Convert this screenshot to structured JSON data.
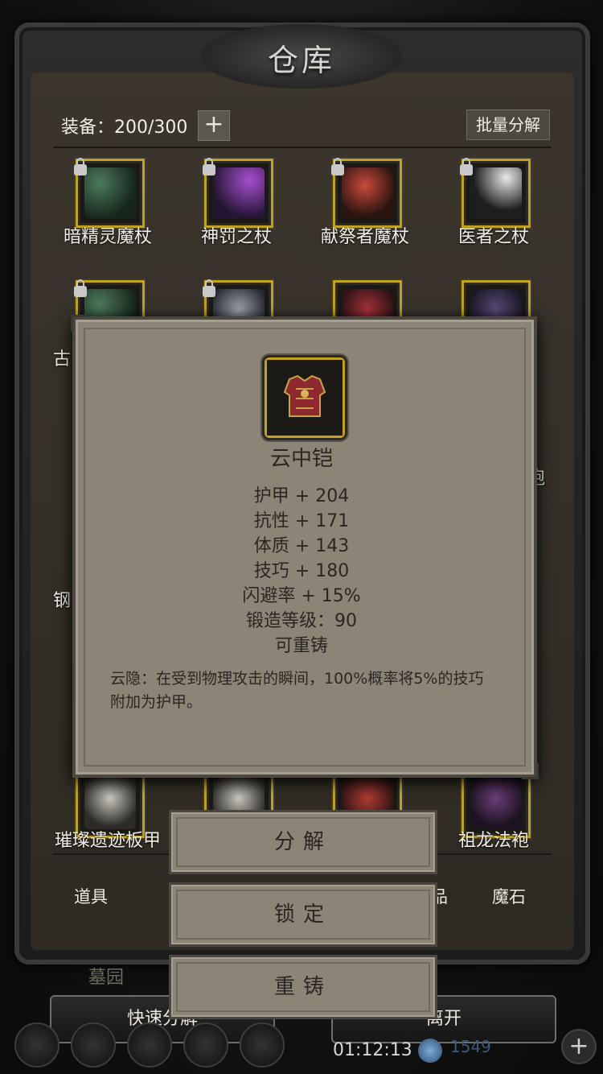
{
  "warehouse": {
    "title": "仓库",
    "equip_count": "装备：200/300",
    "add_slot_label": "+",
    "bulk_decompose_label": "批量分解"
  },
  "items": [
    {
      "name": "暗精灵魔杖",
      "locked": true,
      "art": "staff-green"
    },
    {
      "name": "神罚之杖",
      "locked": true,
      "art": "staff-purple"
    },
    {
      "name": "献祭者魔杖",
      "locked": true,
      "art": "staff-red"
    },
    {
      "name": "医者之杖",
      "locked": true,
      "art": "staff-white"
    },
    {
      "name": "古",
      "locked": true,
      "art": "staff-green"
    },
    {
      "name": "",
      "locked": true,
      "art": "armor-silver"
    },
    {
      "name": "",
      "locked": false,
      "art": "armor-red"
    },
    {
      "name": "袍",
      "locked": false,
      "art": "robe-dark"
    },
    {
      "name": "钢",
      "locked": false,
      "art": "none"
    },
    {
      "name": "璀璨遗迹板甲",
      "locked": false,
      "art": "armor-silver"
    },
    {
      "name": "祖龙法袍",
      "locked": false,
      "art": "robe-purple"
    }
  ],
  "tabs": [
    "道具",
    "品",
    "魔石"
  ],
  "bottom_bar": {
    "quick_decompose": "快速分解",
    "leave": "离开",
    "scene_label": "墓园",
    "timer": "01:12:13",
    "gems": "1549",
    "plus": "+"
  },
  "tooltip": {
    "item_name": "云中铠",
    "stats": [
      "护甲 + 204",
      "抗性 + 171",
      "体质 + 143",
      "技巧 + 180",
      "闪避率 + 15%",
      "锻造等级：90",
      "可重铸"
    ],
    "description": "云隐：在受到物理攻击的瞬间，100%概率将5%的技巧附加为护甲。"
  },
  "actions": {
    "decompose": "分解",
    "lock": "锁定",
    "reforge": "重铸"
  },
  "colors": {
    "slot_border": "#c2a21c",
    "popup_bg": "#8c8577",
    "popup_text": "#2a2722"
  }
}
